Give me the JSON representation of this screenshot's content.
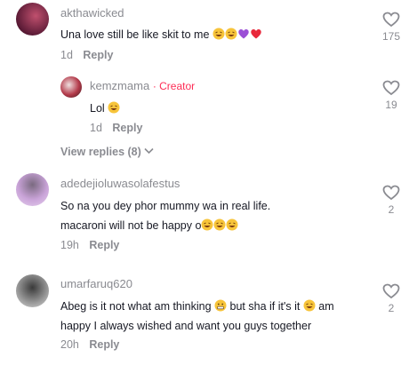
{
  "comments": [
    {
      "username": "akthawicked",
      "text": "Una love still be like skit to me",
      "emojis": [
        "laughing-face-emoji",
        "laughing-face-emoji",
        "purple-heart-emoji",
        "red-heart-emoji"
      ],
      "time": "1d",
      "reply_label": "Reply",
      "likes": "175"
    },
    {
      "username": "kemzmama",
      "creator_label": "· Creator",
      "text": "Lol",
      "emojis": [
        "laughing-face-emoji"
      ],
      "time": "1d",
      "reply_label": "Reply",
      "likes": "19"
    },
    {
      "username": "adedejioluwasolafestus",
      "text_line1": "So na you dey phor mummy wa in real life.",
      "text_line2": "macaroni will not be happy o",
      "emojis": [
        "laughing-face-emoji",
        "laughing-face-emoji",
        "laughing-face-emoji"
      ],
      "time": "19h",
      "reply_label": "Reply",
      "likes": "2"
    },
    {
      "username": "umarfaruq620",
      "text_line1_a": "Abeg is it not what am thinking",
      "text_line1_b": "but sha if it's it",
      "text_line1_c": "am",
      "text_line2": "happy I always wished and want you guys together",
      "time": "20h",
      "reply_label": "Reply",
      "likes": "2"
    }
  ],
  "view_replies": "View replies (8)",
  "colors": {
    "accent": "#fe2c55",
    "muted": "#8a8b91",
    "text": "#161823"
  }
}
